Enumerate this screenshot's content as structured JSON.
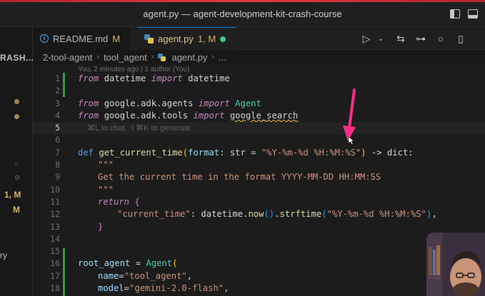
{
  "window": {
    "title": "agent.py — agent-development-kit-crash-course"
  },
  "sidebar": {
    "section_label": "RASH...",
    "status_marks": [
      "1, M",
      "M"
    ],
    "bottom_label": "ry"
  },
  "tabs": [
    {
      "label": "README.md",
      "badge": "M",
      "icon": "info-icon"
    },
    {
      "label": "agent.py",
      "badge": "1, M",
      "icon": "python-icon",
      "dirty": true
    }
  ],
  "breadcrumb": {
    "items": [
      "2-tool-agent",
      "tool_agent",
      "agent.py",
      "..."
    ]
  },
  "editor": {
    "blame": "You, 2 minutes ago | 1 author (You)",
    "inline_hint": "⌘L to chat, ⇧⌘K to generate",
    "line_numbers": [
      "1",
      "2",
      "3",
      "4",
      "5",
      "6",
      "7",
      "8",
      "9",
      "10",
      "11",
      "12",
      "13",
      "14",
      "15",
      "16",
      "17",
      "18"
    ],
    "lines": {
      "l1": {
        "kw1": "from",
        "mod": " datetime ",
        "kw2": "import",
        "name": " datetime"
      },
      "l3": {
        "kw1": "from",
        "mod": " google.adk.agents ",
        "kw2": "import",
        "name": " Agent"
      },
      "l4": {
        "kw1": "from",
        "mod": " google.adk.tools ",
        "kw2": "import",
        "name": "google_search"
      },
      "l7": {
        "def": "def",
        "fn": "get_current_time",
        "p1": "(",
        "param": "format",
        "colon": ": str = ",
        "default": "\"%Y-%m-%d %H:%M:%S\"",
        "p2": ")",
        "ret": " -> dict:"
      },
      "l8": "\"\"\"",
      "l9": "Get the current time in the format YYYY-MM-DD HH:MM:SS",
      "l10": "\"\"\"",
      "l11": {
        "kw": "return",
        "brace": " {"
      },
      "l12": {
        "key": "\"current_time\"",
        "colon": ": datetime.",
        "now": "now",
        "call": "().",
        "strf": "strftime",
        "p1": "(",
        "fmt": "\"%Y-%m-%d %H:%M:%S\"",
        "p2": ")",
        "comma": ","
      },
      "l13": "}",
      "l16": {
        "var": "root_agent",
        "eq": " = ",
        "cls": "Agent",
        "p": "("
      },
      "l17": {
        "arg": "name",
        "eq": "=",
        "val": "\"tool_agent\"",
        "comma": ","
      },
      "l18": {
        "arg": "model",
        "eq": "=",
        "val": "\"gemini-2.0-flash\"",
        "comma": ","
      }
    }
  },
  "colors": {
    "accent": "#0078d4",
    "annotation_arrow": "#ff2d87",
    "modified": "#d7b46a"
  }
}
